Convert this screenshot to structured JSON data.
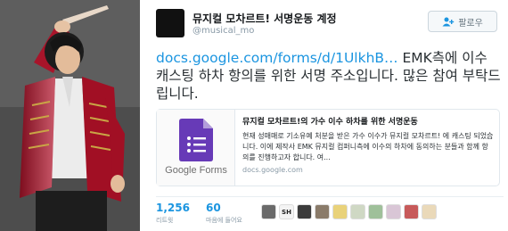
{
  "profile": {
    "name": "뮤지컬 모차르트! 서명운동 계정",
    "handle": "@musical_mo",
    "follow_label": "팔로우"
  },
  "tweet": {
    "link_text": "docs.google.com/forms/d/1UlkhB…",
    "text_after_link": " EMK측에 이수 캐스팅 하차 항의를 위한 서명 주소입니다. 많은 참여 부탁드립니다."
  },
  "card": {
    "thumb_label": "Google Forms",
    "title": "뮤지컬 모차르트!의 가수 이수 하차를 위한 서명운동",
    "description": "현재 성매매로 기소유예 처분을 받은 가수 이수가 뮤지컬 모차르트! 에 캐스팅 되었습니다. 이에 제작사 EMK 뮤지컬 컴퍼니측에 이수의 하차에 동의하는 분들과 함께 항의를 진행하고자 합니다. 여...",
    "domain": "docs.google.com"
  },
  "stats": {
    "retweets_count": "1,256",
    "retweets_label": "리트윗",
    "likes_count": "60",
    "likes_label": "마음에 들어요"
  },
  "faces": [
    "",
    "SH",
    "",
    "",
    "",
    "",
    "",
    "",
    "",
    "",
    ""
  ],
  "colors": {
    "link": "#1b95e0",
    "forms_purple": "#673ab7",
    "coat_red": "#b3122a"
  }
}
